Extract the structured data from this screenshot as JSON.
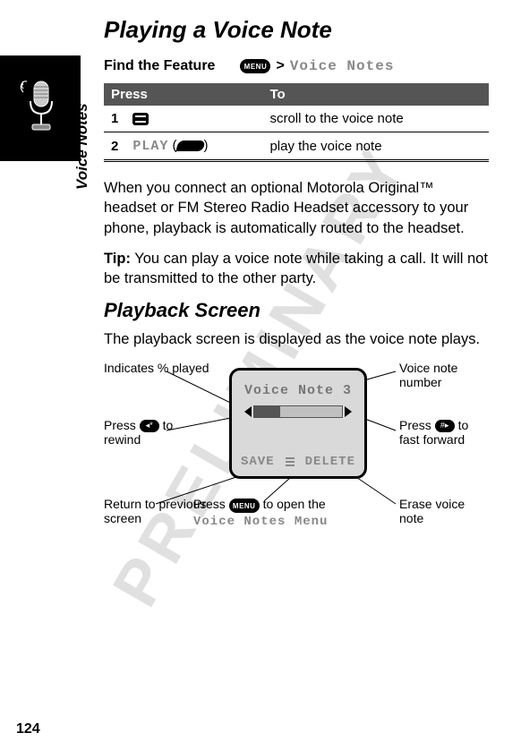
{
  "title": "Playing a Voice Note",
  "side_label": "Voice Notes",
  "watermark": "PRELIMINARY",
  "feature": {
    "label": "Find the Feature",
    "menu_key": "MENU",
    "gt": ">",
    "path_item": "Voice Notes"
  },
  "table": {
    "head_press": "Press",
    "head_to": "To",
    "rows": [
      {
        "num": "1",
        "press_type": "nav",
        "press_text": "",
        "to": "scroll to the voice note"
      },
      {
        "num": "2",
        "press_type": "soft",
        "press_text": "PLAY",
        "to": "play the voice note"
      }
    ]
  },
  "para1": "When you connect an optional Motorola Original™ headset or FM Stereo Radio Headset accessory to your phone, playback is automatically routed to the headset.",
  "tip_label": "Tip:",
  "tip_text": " You can play a voice note while taking a call. It will not be transmitted to the other party.",
  "h2": "Playback Screen",
  "para2": "The playback screen is displayed as the voice note plays.",
  "screen": {
    "title": "Voice Note 3",
    "left_soft": "SAVE",
    "right_soft": "DELETE"
  },
  "callouts": {
    "tl": "Indicates % played",
    "ml_pre": "Press ",
    "ml_key": "◂*",
    "ml_post": " to rewind",
    "bl": "Return to previous screen",
    "tr": "Voice note number",
    "mr_pre": "Press ",
    "mr_key": "#▸",
    "mr_post": " to fast forward",
    "br": "Erase voice note",
    "bm_pre": "Press ",
    "bm_key": "MENU",
    "bm_mid": " to open the ",
    "bm_menu": "Voice Notes Menu"
  },
  "page_number": "124"
}
